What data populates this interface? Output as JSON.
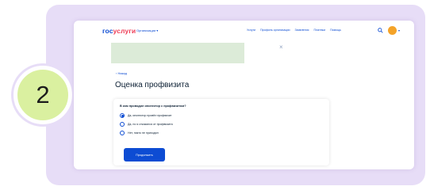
{
  "step": {
    "number": "2"
  },
  "header": {
    "logo_left": "гос",
    "logo_right": "услуги",
    "org_menu": "Организации ▾",
    "nav_items": [
      "Услуги",
      "Профиль организации",
      "Заявления",
      "Платежи",
      "Помощь"
    ],
    "avatar_chevron": "▾"
  },
  "banner": {
    "close": "×"
  },
  "page": {
    "back": "‹ Назад",
    "title": "Оценка профвизита"
  },
  "form": {
    "question": "В ком проводил инспектор с профвизитом?",
    "options": [
      {
        "label": "Да, инспектор провёл профвизит",
        "checked": true
      },
      {
        "label": "Да, но я отказался от профвизита",
        "checked": false
      },
      {
        "label": "Нет, никто не приходил",
        "checked": false
      }
    ],
    "submit": "Продолжить"
  },
  "colors": {
    "brand_blue": "#0d4cd3",
    "brand_red": "#ee3f58",
    "panel": "#e7ddf7",
    "step_circle": "#daf0a0"
  },
  "icons": [
    "search-icon",
    "avatar",
    "close-icon",
    "radio-icon"
  ]
}
